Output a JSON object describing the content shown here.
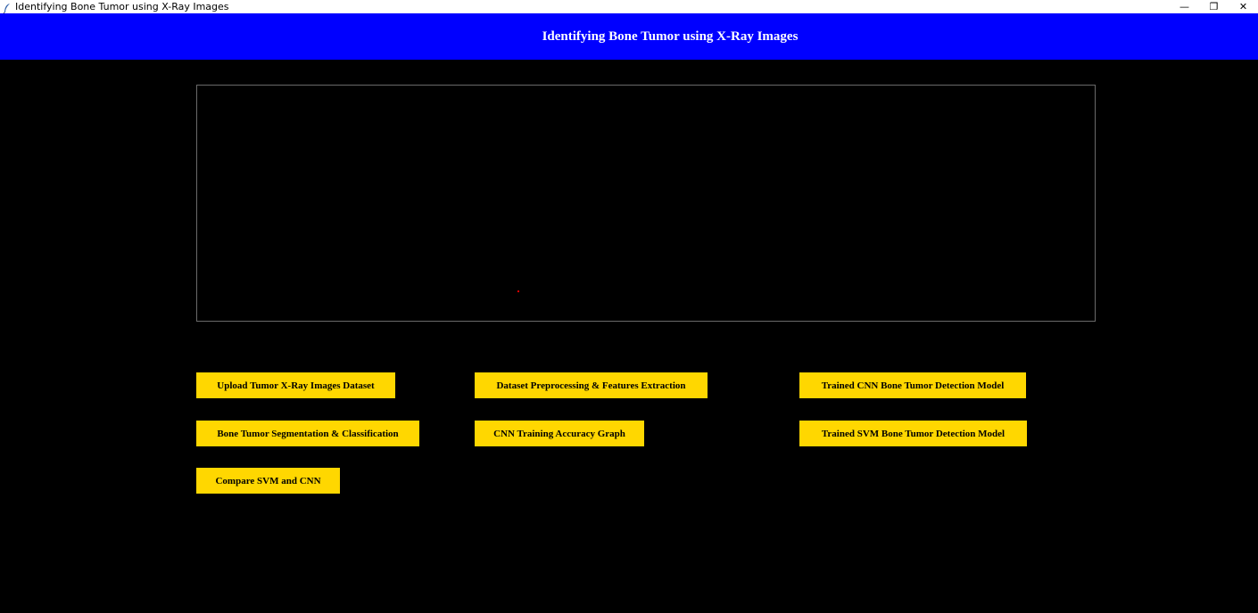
{
  "window": {
    "title": "Identifying Bone Tumor using X-Ray Images",
    "controls": {
      "minimize": "—",
      "restore": "❐",
      "close": "✕"
    }
  },
  "header": {
    "heading": "Identifying Bone Tumor using X-Ray Images",
    "background_color": "#0000ff"
  },
  "output_area": {
    "text": ""
  },
  "buttons": {
    "upload": "Upload Tumor X-Ray Images Dataset",
    "preprocessing": "Dataset Preprocessing & Features Extraction",
    "trained_cnn": "Trained CNN Bone Tumor Detection Model",
    "segmentation": "Bone Tumor Segmentation & Classification",
    "cnn_graph": "CNN Training Accuracy Graph",
    "trained_svm": "Trained SVM Bone Tumor Detection Model",
    "compare": "Compare SVM and CNN",
    "button_color": "#ffd700"
  },
  "icons": {
    "app": "feather-icon"
  }
}
